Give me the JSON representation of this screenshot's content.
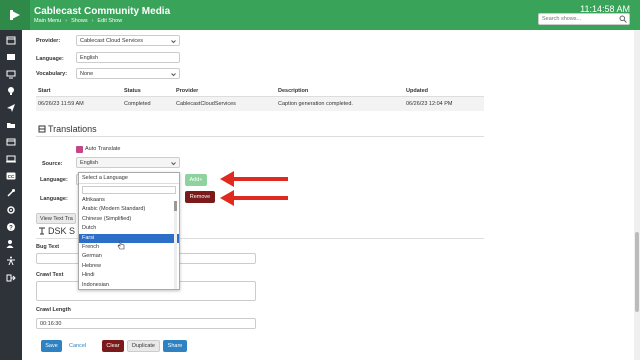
{
  "header": {
    "title": "Cablecast Community Media",
    "breadcrumbs": [
      "Main Menu",
      "Shows",
      "Edit Show"
    ],
    "clock": "11:14:58 AM",
    "search_placeholder": "Search shows..."
  },
  "sidebar": {
    "icons": [
      "calendar-icon",
      "film-icon",
      "tv-icon",
      "bulb-icon",
      "send-icon",
      "folder-icon",
      "box-icon",
      "monitor-icon",
      "cc-icon",
      "wrench-icon",
      "gear-icon",
      "help-icon",
      "users-icon",
      "accessibility-icon",
      "logout-icon"
    ]
  },
  "form": {
    "provider_label": "Provider:",
    "provider_value": "Cablecast Cloud Services",
    "language_label": "Language:",
    "language_value": "English",
    "vocabulary_label": "Vocabulary:",
    "vocabulary_value": "None"
  },
  "captions_table": {
    "headers": [
      "Start",
      "Status",
      "Provider",
      "Description",
      "Updated"
    ],
    "rows": [
      [
        "06/26/23 11:59 AM",
        "Completed",
        "CablecastCloudServices",
        "Caption generation completed.",
        "06/26/23 12:04 PM"
      ]
    ]
  },
  "translations": {
    "title": "Translations",
    "auto_translate_label": "Auto Translate",
    "source_label": "Source:",
    "source_value": "English",
    "language_label": "Language:",
    "select_placeholder": "Select a Language",
    "add_button": "Add+",
    "remove_button": "Remove",
    "language2_label": "Language:",
    "view_text_button": "View Text Tra",
    "options": [
      "Afrikaans",
      "Arabic (Modern Standard)",
      "Chinese (Simplified)",
      "Dutch",
      "Farsi",
      "French",
      "German",
      "Hebrew",
      "Hindi",
      "Indonesian"
    ],
    "selected_option": "Farsi"
  },
  "dsk": {
    "title": "DSK S",
    "bug_text_label": "Bug Text",
    "crawl_text_label": "Crawl Text",
    "crawl_length_label": "Crawl Length",
    "crawl_length_value": "00:16:30"
  },
  "footer": {
    "save": "Save",
    "cancel": "Cancel",
    "clear": "Clear",
    "duplicate": "Duplicate",
    "share": "Share"
  },
  "colors": {
    "header_green": "#3aa35a",
    "sidebar_dark": "#2d3338",
    "arrow_red": "#e02a1f",
    "primary_blue": "#2e82c2"
  }
}
